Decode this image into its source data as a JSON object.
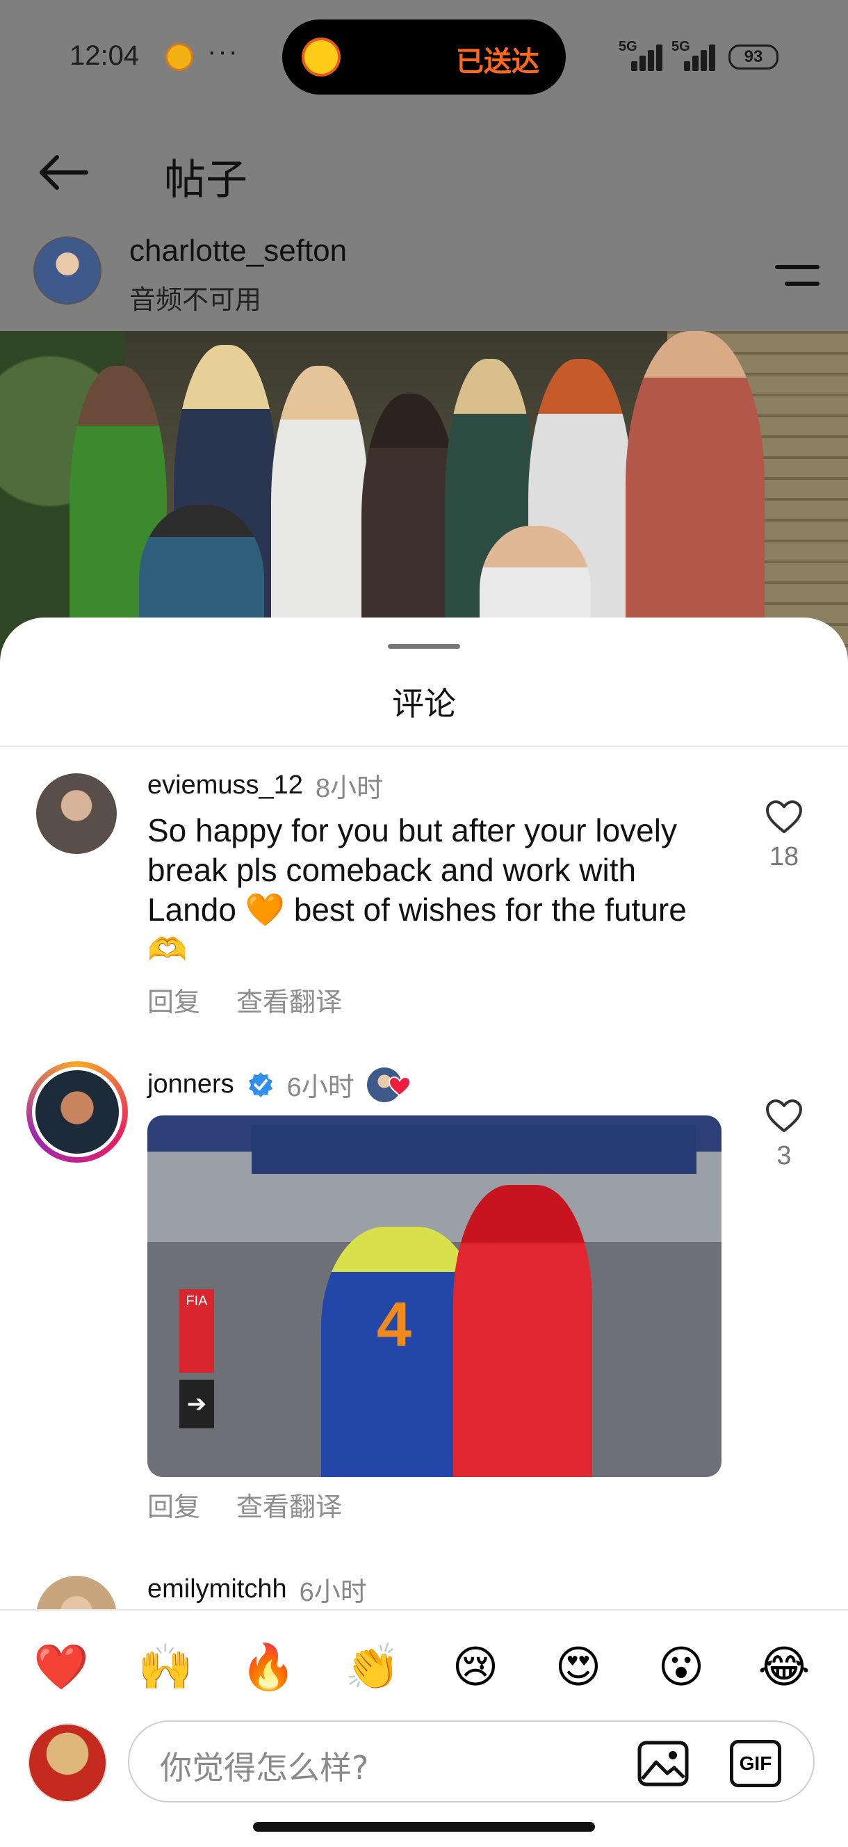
{
  "status_bar": {
    "time": "12:04",
    "dots": "···",
    "island_text": "已送达",
    "signal1": "5G",
    "signal2": "5G",
    "battery": "93"
  },
  "header": {
    "title": "帖子"
  },
  "post": {
    "author": "charlotte_sefton",
    "subtitle": "音频不可用"
  },
  "sheet": {
    "title": "评论"
  },
  "comments": [
    {
      "user": "eviemuss_12",
      "time": "8小时",
      "text": "So happy for you but after your lovely break pls comeback and work with Lando 🧡 best of wishes for the future 🫶",
      "likes": "18",
      "reply": "回复",
      "translate": "查看翻译"
    },
    {
      "user": "jonners",
      "time": "6小时",
      "likes": "3",
      "reply": "回复",
      "translate": "查看翻译",
      "gif_number": "4",
      "gif_sign": "FIA"
    },
    {
      "user": "emilymitchh",
      "time": "6小时"
    }
  ],
  "reactions": [
    "❤️",
    "🙌",
    "🔥",
    "👏",
    "😢",
    "😍",
    "😮",
    "😂"
  ],
  "composer": {
    "placeholder": "你觉得怎么样?",
    "gif_label": "GIF"
  },
  "colors": {
    "accent_heart": "#ee1d3f",
    "verified_blue": "#2f8ef0",
    "island_text": "#ff6a1a"
  }
}
